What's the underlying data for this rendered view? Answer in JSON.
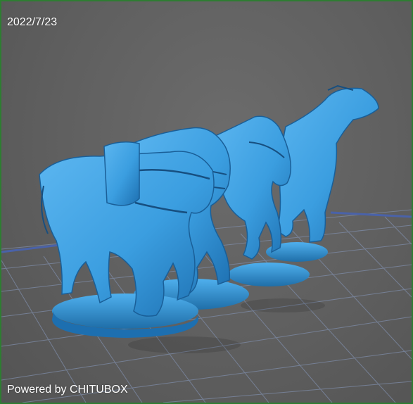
{
  "viewport": {
    "date": "2022/7/23",
    "watermark": "Powered by CHITUBOX"
  },
  "scene": {
    "model": "four-horse-team-miniature",
    "model_color": "#3b9ee0",
    "model_shadow_color": "#1d6fb0",
    "grid_color": "#7e8ca8",
    "grid_accent_color": "#4a62a8",
    "background_color": "#5f5f5f",
    "frame_color": "#2e7d32"
  }
}
